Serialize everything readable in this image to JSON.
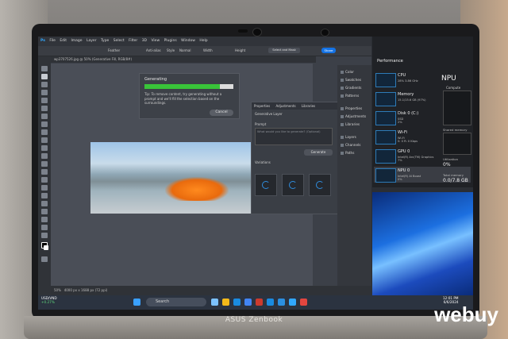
{
  "photoshop": {
    "menu": [
      "File",
      "Edit",
      "Image",
      "Layer",
      "Type",
      "Select",
      "Filter",
      "3D",
      "View",
      "Plugins",
      "Window",
      "Help"
    ],
    "options": [
      "Feather",
      "Anti-alias",
      "Style",
      "Normal",
      "Width",
      "Height",
      "Select and Mask"
    ],
    "share_label": "Share",
    "doc_tab": "wp3707526.jpg @ 50% (Generative Fill, RGB/8#)",
    "status": {
      "zoom": "50%",
      "size": "4000 px x 1688 px (72 ppi)"
    }
  },
  "generating_dialog": {
    "title": "Generating",
    "progress": 0.85,
    "tip_label": "Tip:",
    "tip": "To remove content, try generating without a prompt and we'll fill the selection based on the surroundings.",
    "cancel_label": "Cancel"
  },
  "properties_panel": {
    "tabs": [
      "Properties",
      "Adjustments",
      "Libraries"
    ],
    "layer": "Generative Layer",
    "prompt_label": "Prompt",
    "prompt_placeholder": "What would you like to generate? (Optional)",
    "generate_label": "Generate",
    "variations_label": "Variations"
  },
  "right_panel": {
    "items": [
      "Color",
      "Swatches",
      "Gradients",
      "Patterns",
      "Properties",
      "Adjustments",
      "Libraries",
      "Layers",
      "Channels",
      "Paths"
    ]
  },
  "task_manager": {
    "title": "Performance",
    "rows": [
      {
        "name": "CPU",
        "sub": "28% 3.86 GHz"
      },
      {
        "name": "Memory",
        "sub": "15.1/15.6 GB (97%)"
      },
      {
        "name": "Disk 0 (C:)",
        "sub": "SSD\n2%"
      },
      {
        "name": "Wi-Fi",
        "sub": "Wi-Fi\nS: 0 R: 0 Kbps"
      },
      {
        "name": "GPU 0",
        "sub": "Intel(R) Arc(TM) Graphics\n7%"
      },
      {
        "name": "NPU 0",
        "sub": "Intel(R) AI Boost\n0%"
      }
    ],
    "npu_heading": "NPU",
    "compute_label": "Compute",
    "shared_mem_label": "Shared memory usa",
    "util_label": "Utilization",
    "util_value": "0%",
    "total_mem_label": "Total memory",
    "total_mem_value": "0.0/7.8 GB"
  },
  "taskbar": {
    "ticker": "USD/VND",
    "change": "+0.27%",
    "search_placeholder": "Search",
    "time": "12:01 PM",
    "date": "6/6/2024"
  },
  "laptop_brand": "ASUS Zenbook",
  "watermark": "webuy"
}
